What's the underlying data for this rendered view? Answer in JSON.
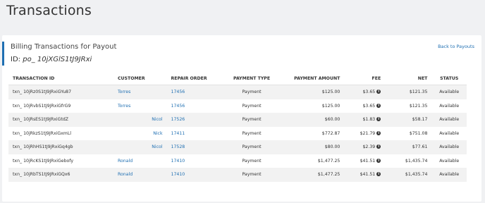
{
  "page": {
    "title": "Transactions"
  },
  "card": {
    "title": "Billing Transactions for Payout",
    "id_label": "ID:",
    "id_value": "po_ 10jXGlS1tJ9JRxi",
    "back_link": "Back to Payouts"
  },
  "table": {
    "headers": {
      "transaction_id": "TRANSACTION ID",
      "customer": "CUSTOMER",
      "repair_order": "REPAIR ORDER",
      "payment_type": "PAYMENT TYPE",
      "payment_amount": "PAYMENT AMOUNT",
      "fee": "FEE",
      "net": "NET",
      "status": "STATUS"
    },
    "rows": [
      {
        "txn": "txn_ 10jRz0S1tJ9JRxiGYu87",
        "customer": "Torres",
        "ro": "17456",
        "type": "Payment",
        "amount": "$125.00",
        "fee": "$3.65",
        "net": "$121.35",
        "status": "Available"
      },
      {
        "txn": "txn_ 10jRvbS1tJ9JRxiGfrG9",
        "customer": "Torres",
        "ro": "17456",
        "type": "Payment",
        "amount": "$125.00",
        "fee": "$3.65",
        "net": "$121.35",
        "status": "Available"
      },
      {
        "txn": "txn_ 10jRsES1tJ9JRxiGtdZ",
        "customer": "Nicol",
        "ro": "17526",
        "type": "Payment",
        "amount": "$60.00",
        "fee": "$1.83",
        "net": "$58.17",
        "status": "Available"
      },
      {
        "txn": "txn_ 10jRkzS1tJ9JRxiGxmLl",
        "customer": "Nick",
        "ro": "17411",
        "type": "Payment",
        "amount": "$772.87",
        "fee": "$21.79",
        "net": "$751.08",
        "status": "Available"
      },
      {
        "txn": "txn_ 10jRhHS1tJ9JRxiGq4gb",
        "customer": "Nicol",
        "ro": "17528",
        "type": "Payment",
        "amount": "$80.00",
        "fee": "$2.39",
        "net": "$77.61",
        "status": "Available"
      },
      {
        "txn": "txn_ 10jRcKS1tJ9JRxiGebofy",
        "customer": "Ronald",
        "ro": "17410",
        "type": "Payment",
        "amount": "$1,477.25",
        "fee": "$41.51",
        "net": "$1,435.74",
        "status": "Available"
      },
      {
        "txn": "txn_ 10jRbTS1tJ9JRxiGQx6",
        "customer": "Ronald",
        "ro": "17410",
        "type": "Payment",
        "amount": "$1,477.25",
        "fee": "$41.51",
        "net": "$1,435.74",
        "status": "Available"
      }
    ]
  },
  "icons": {
    "fee_info": "info-icon"
  },
  "colors": {
    "accent": "#1f6fb2",
    "background": "#f0f1f3"
  }
}
